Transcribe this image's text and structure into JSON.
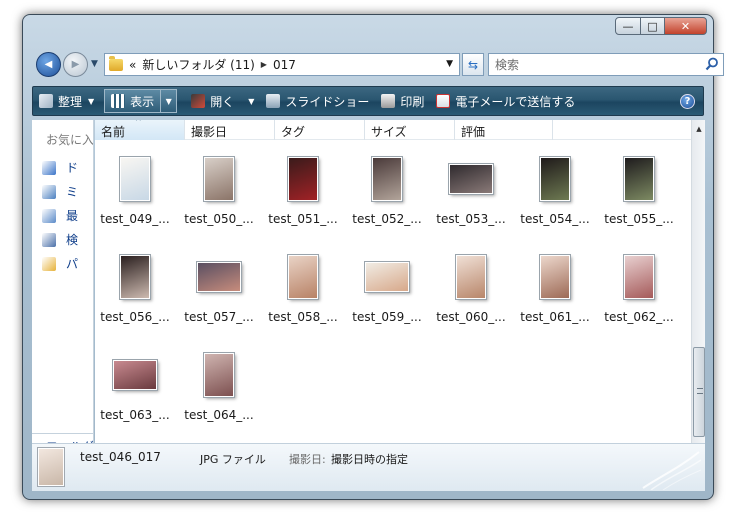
{
  "window": {
    "controls": {
      "minimize": "—",
      "maximize": "□",
      "close": "✕"
    }
  },
  "nav": {
    "back_icon": "back-arrow-icon",
    "forward_icon": "forward-arrow-icon",
    "back_glyph": "◀",
    "forward_glyph": "▶",
    "history_glyph": "▼"
  },
  "address": {
    "overflow": "«",
    "crumbs": [
      "新しいフォルダ (11)",
      "017"
    ],
    "separator": "▶",
    "dropdown_glyph": "▼",
    "refresh_glyph": "⇆"
  },
  "search": {
    "placeholder": "検索"
  },
  "toolbar": {
    "organize": "整理",
    "view": "表示",
    "open": "開く",
    "slideshow": "スライドショー",
    "print": "印刷",
    "email": "電子メールで送信する",
    "caret": "▼",
    "help": "?"
  },
  "navpane": {
    "favorites": "お気に入",
    "links": [
      {
        "label": "ド",
        "icon": "documents-icon",
        "color": "#3b74c8"
      },
      {
        "label": "ミ",
        "icon": "music-icon",
        "color": "#4a7fc0"
      },
      {
        "label": "最",
        "icon": "recent-places-icon",
        "color": "#5a8ac8"
      },
      {
        "label": "検",
        "icon": "search-folder-icon",
        "color": "#4a6fa8"
      },
      {
        "label": "パ",
        "icon": "public-folder-icon",
        "color": "#e6b23a"
      }
    ],
    "folders": "フォルダ"
  },
  "columns": [
    "名前",
    "撮影日",
    "タグ",
    "サイズ",
    "評価"
  ],
  "sort_glyph": "^",
  "files": [
    {
      "label": "test_049_...",
      "tone": [
        "#f8f6f2",
        "#c8d8e6"
      ],
      "shape": "portrait"
    },
    {
      "label": "test_050_...",
      "tone": [
        "#d8cfc8",
        "#8b7468"
      ],
      "shape": "portrait"
    },
    {
      "label": "test_051_...",
      "tone": [
        "#3a1b1b",
        "#a12226"
      ],
      "shape": "portrait"
    },
    {
      "label": "test_052_...",
      "tone": [
        "#4a3a3a",
        "#b2a49a"
      ],
      "shape": "portrait"
    },
    {
      "label": "test_053_...",
      "tone": [
        "#2f2a2e",
        "#8a7a78"
      ],
      "shape": "landscape"
    },
    {
      "label": "test_054_...",
      "tone": [
        "#1f1a1a",
        "#6e7a52"
      ],
      "shape": "portrait"
    },
    {
      "label": "test_055_...",
      "tone": [
        "#1e1b1d",
        "#7d8a62"
      ],
      "shape": "portrait"
    },
    {
      "label": "test_056_...",
      "tone": [
        "#2a1f1f",
        "#cdbab0"
      ],
      "shape": "portrait"
    },
    {
      "label": "test_057_...",
      "tone": [
        "#5a4f62",
        "#c78c7c"
      ],
      "shape": "landscape"
    },
    {
      "label": "test_058_...",
      "tone": [
        "#e9d3c6",
        "#b88266"
      ],
      "shape": "portrait"
    },
    {
      "label": "test_059_...",
      "tone": [
        "#f1ece4",
        "#d7a88a"
      ],
      "shape": "landscape"
    },
    {
      "label": "test_060_...",
      "tone": [
        "#f0e0d6",
        "#b8866a"
      ],
      "shape": "portrait"
    },
    {
      "label": "test_061_...",
      "tone": [
        "#ecd7cc",
        "#9d6a56"
      ],
      "shape": "portrait"
    },
    {
      "label": "test_062_...",
      "tone": [
        "#e8d0d0",
        "#a55a5a"
      ],
      "shape": "portrait"
    },
    {
      "label": "test_063_...",
      "tone": [
        "#c88a90",
        "#6a3a3e"
      ],
      "shape": "landscape"
    },
    {
      "label": "test_064_...",
      "tone": [
        "#cfb4b0",
        "#7d5050"
      ],
      "shape": "portrait"
    }
  ],
  "scroll": {
    "up": "▲",
    "down": "▼"
  },
  "details": {
    "name": "test_046_017",
    "type": "JPG ファイル",
    "date_label": "撮影日:",
    "date_value": "撮影日時の指定"
  }
}
